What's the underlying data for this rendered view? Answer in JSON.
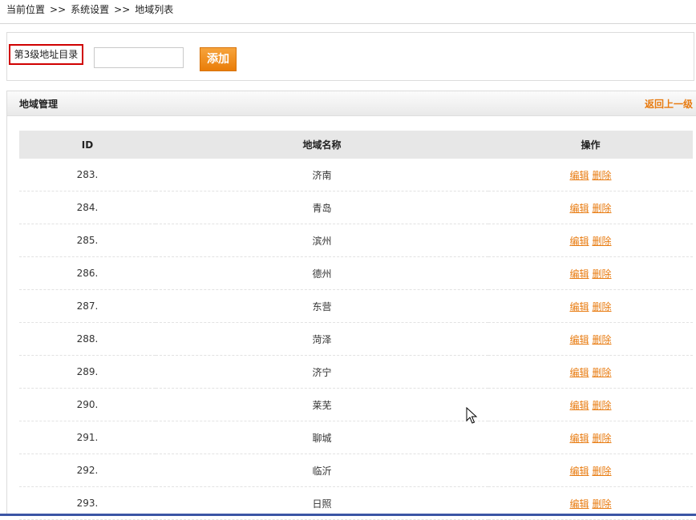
{
  "breadcrumb": {
    "items": [
      "当前位置",
      "系统设置",
      "地域列表"
    ],
    "separator": ">>"
  },
  "add_form": {
    "directory_label": "第3级地址目录",
    "input_value": "",
    "add_button": "添加"
  },
  "panel": {
    "title": "地域管理",
    "back_link": "返回上一级"
  },
  "table": {
    "headers": [
      "ID",
      "地域名称",
      "操作"
    ],
    "rows": [
      {
        "id": "283.",
        "name": "济南"
      },
      {
        "id": "284.",
        "name": "青岛"
      },
      {
        "id": "285.",
        "name": "滨州"
      },
      {
        "id": "286.",
        "name": "德州"
      },
      {
        "id": "287.",
        "name": "东营"
      },
      {
        "id": "288.",
        "name": "菏泽"
      },
      {
        "id": "289.",
        "name": "济宁"
      },
      {
        "id": "290.",
        "name": "莱芜"
      },
      {
        "id": "291.",
        "name": "聊城"
      },
      {
        "id": "292.",
        "name": "临沂"
      },
      {
        "id": "293.",
        "name": "日照"
      }
    ],
    "actions": {
      "edit": "编辑",
      "delete": "删除"
    }
  },
  "colors": {
    "accent": "#e87b10",
    "highlight_border": "#d00000"
  }
}
